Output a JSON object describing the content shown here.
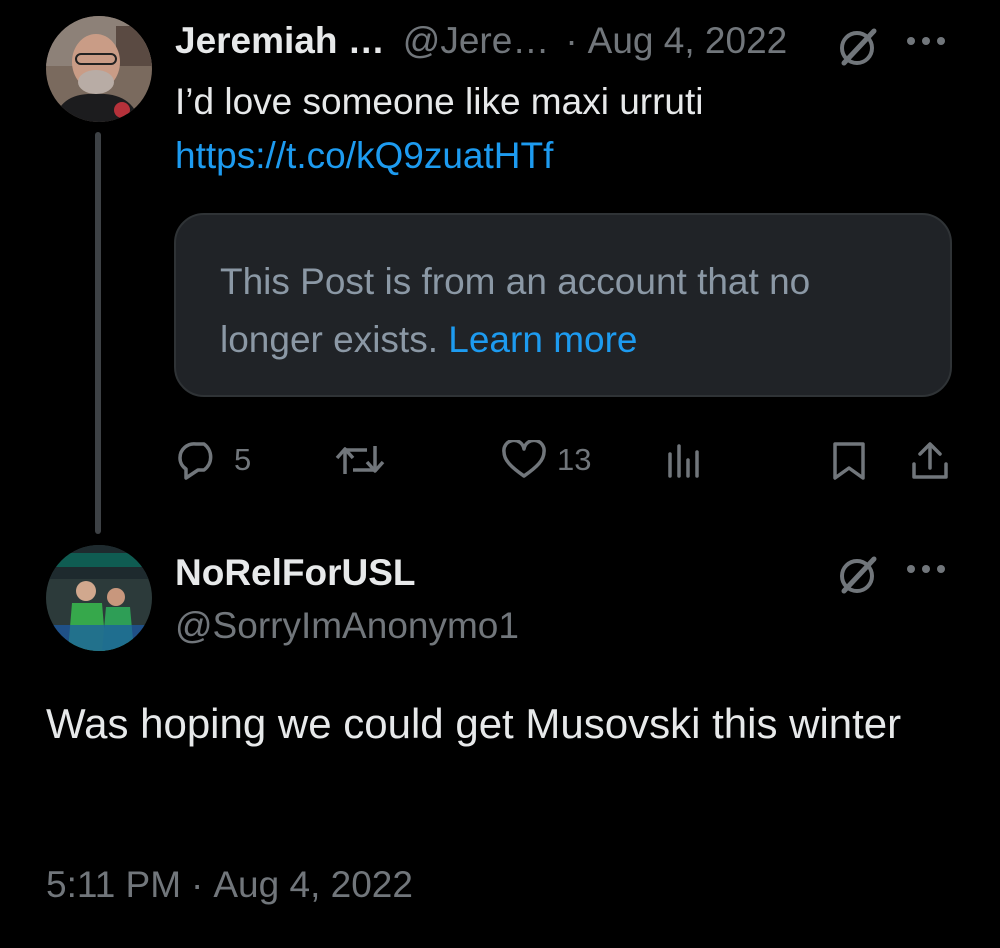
{
  "parent_tweet": {
    "author_name": "Jeremiah …",
    "author_handle": "@Jere…",
    "separator": "·",
    "date": "Aug 4, 2022",
    "text": "I’d love someone like maxi urruti",
    "link": "https://t.co/kQ9zuatHTf",
    "quote_notice": {
      "text": "This Post is from an account that no longer exists.",
      "learn_more": "Learn more"
    },
    "actions": {
      "replies": "5",
      "retweets": "",
      "likes": "13"
    },
    "icons": {
      "grok": "grok-icon",
      "more": "more-icon",
      "reply": "reply-icon",
      "retweet": "retweet-icon",
      "like": "heart-icon",
      "views": "views-icon",
      "bookmark": "bookmark-icon",
      "share": "share-icon"
    }
  },
  "main_tweet": {
    "author_name": "NoRelForUSL",
    "author_handle": "@SorryImAnonymo1",
    "text": "Was hoping we could get Musovski this winter",
    "time": "5:11 PM",
    "separator": "·",
    "date": "Aug 4, 2022"
  },
  "colors": {
    "background": "#000000",
    "primary_text": "#e7e9ea",
    "secondary_text": "#71767b",
    "link": "#1d9bf0",
    "card_background": "#202327",
    "thread_line": "#3d4145"
  }
}
